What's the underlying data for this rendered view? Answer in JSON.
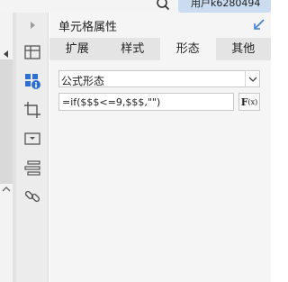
{
  "topbar": {
    "user_label": "用户k6280494"
  },
  "panel": {
    "title": "单元格属性"
  },
  "tabs": [
    {
      "label": "扩展"
    },
    {
      "label": "样式"
    },
    {
      "label": "形态"
    },
    {
      "label": "其他"
    }
  ],
  "active_tab": "形态",
  "form_select": {
    "value": "公式形态"
  },
  "formula": {
    "value": "=if($$$<=9,$$$,\"\")"
  },
  "fx_button": {
    "label": "F",
    "sub": "(x)"
  },
  "icons": {
    "rail": [
      "expand-arrow-icon",
      "cell-attribute-icon",
      "cell-element-icon",
      "crop-icon",
      "widget-icon",
      "condition-icon",
      "hyperlink-icon"
    ]
  },
  "colors": {
    "accent": "#3d7ed8",
    "active_icon": "#2f6fd1",
    "user_pill": "#c9dcf0"
  }
}
